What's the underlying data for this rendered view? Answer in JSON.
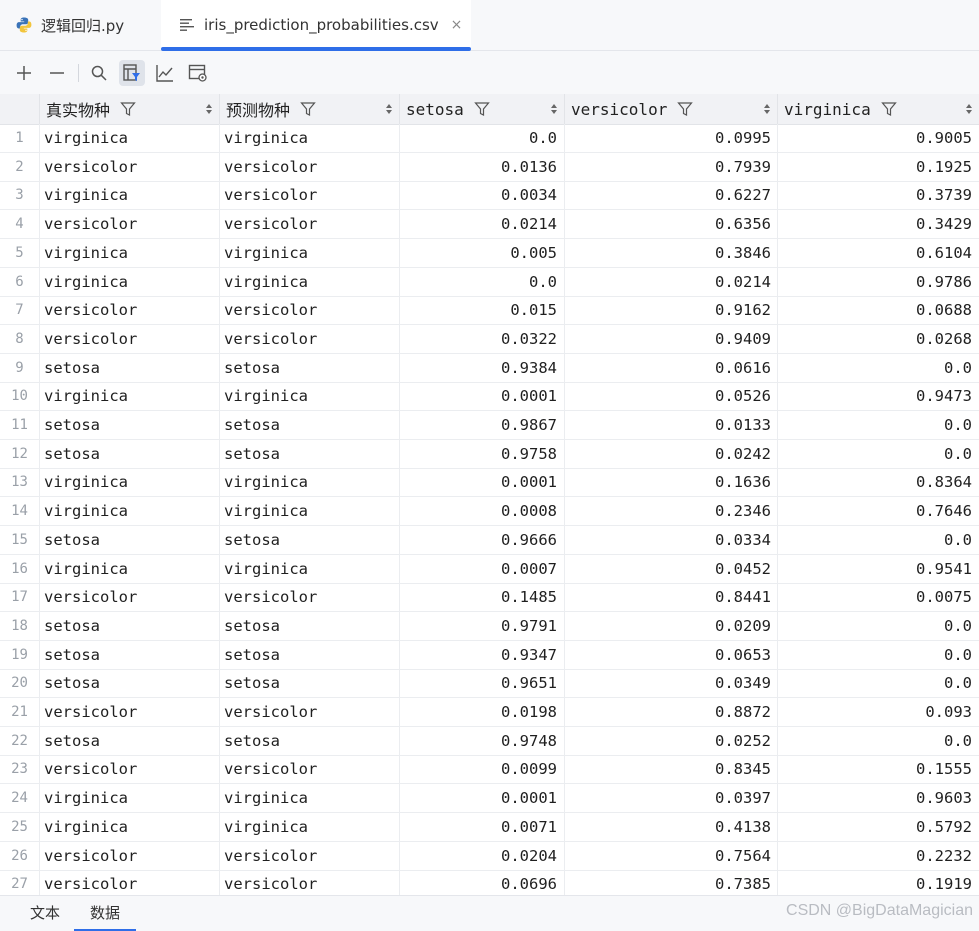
{
  "tabs": [
    {
      "label": "逻辑回归.py",
      "icon": "python-icon"
    },
    {
      "label": "iris_prediction_probabilities.csv",
      "icon": "text-file-icon",
      "close": "×"
    }
  ],
  "toolbar": {
    "buttons": [
      "add-row-icon",
      "remove-row-icon",
      "search-icon",
      "filter-icon",
      "chart-icon",
      "view-icon"
    ]
  },
  "table": {
    "columns": [
      "真实物种",
      "预测物种",
      "setosa",
      "versicolor",
      "virginica"
    ],
    "rows": [
      [
        "1",
        "virginica",
        "virginica",
        "0.0",
        "0.0995",
        "0.9005"
      ],
      [
        "2",
        "versicolor",
        "versicolor",
        "0.0136",
        "0.7939",
        "0.1925"
      ],
      [
        "3",
        "virginica",
        "versicolor",
        "0.0034",
        "0.6227",
        "0.3739"
      ],
      [
        "4",
        "versicolor",
        "versicolor",
        "0.0214",
        "0.6356",
        "0.3429"
      ],
      [
        "5",
        "virginica",
        "virginica",
        "0.005",
        "0.3846",
        "0.6104"
      ],
      [
        "6",
        "virginica",
        "virginica",
        "0.0",
        "0.0214",
        "0.9786"
      ],
      [
        "7",
        "versicolor",
        "versicolor",
        "0.015",
        "0.9162",
        "0.0688"
      ],
      [
        "8",
        "versicolor",
        "versicolor",
        "0.0322",
        "0.9409",
        "0.0268"
      ],
      [
        "9",
        "setosa",
        "setosa",
        "0.9384",
        "0.0616",
        "0.0"
      ],
      [
        "10",
        "virginica",
        "virginica",
        "0.0001",
        "0.0526",
        "0.9473"
      ],
      [
        "11",
        "setosa",
        "setosa",
        "0.9867",
        "0.0133",
        "0.0"
      ],
      [
        "12",
        "setosa",
        "setosa",
        "0.9758",
        "0.0242",
        "0.0"
      ],
      [
        "13",
        "virginica",
        "virginica",
        "0.0001",
        "0.1636",
        "0.8364"
      ],
      [
        "14",
        "virginica",
        "virginica",
        "0.0008",
        "0.2346",
        "0.7646"
      ],
      [
        "15",
        "setosa",
        "setosa",
        "0.9666",
        "0.0334",
        "0.0"
      ],
      [
        "16",
        "virginica",
        "virginica",
        "0.0007",
        "0.0452",
        "0.9541"
      ],
      [
        "17",
        "versicolor",
        "versicolor",
        "0.1485",
        "0.8441",
        "0.0075"
      ],
      [
        "18",
        "setosa",
        "setosa",
        "0.9791",
        "0.0209",
        "0.0"
      ],
      [
        "19",
        "setosa",
        "setosa",
        "0.9347",
        "0.0653",
        "0.0"
      ],
      [
        "20",
        "setosa",
        "setosa",
        "0.9651",
        "0.0349",
        "0.0"
      ],
      [
        "21",
        "versicolor",
        "versicolor",
        "0.0198",
        "0.8872",
        "0.093"
      ],
      [
        "22",
        "setosa",
        "setosa",
        "0.9748",
        "0.0252",
        "0.0"
      ],
      [
        "23",
        "versicolor",
        "versicolor",
        "0.0099",
        "0.8345",
        "0.1555"
      ],
      [
        "24",
        "virginica",
        "virginica",
        "0.0001",
        "0.0397",
        "0.9603"
      ],
      [
        "25",
        "virginica",
        "virginica",
        "0.0071",
        "0.4138",
        "0.5792"
      ],
      [
        "26",
        "versicolor",
        "versicolor",
        "0.0204",
        "0.7564",
        "0.2232"
      ],
      [
        "27",
        "versicolor",
        "versicolor",
        "0.0696",
        "0.7385",
        "0.1919"
      ]
    ]
  },
  "bottom_tabs": [
    "文本",
    "数据"
  ],
  "watermark": "CSDN @BigDataMagician",
  "colors": {
    "accent": "#2f6ee8",
    "header_bg": "#f1f2f5",
    "toolbar_bg": "#f7f8fa"
  }
}
